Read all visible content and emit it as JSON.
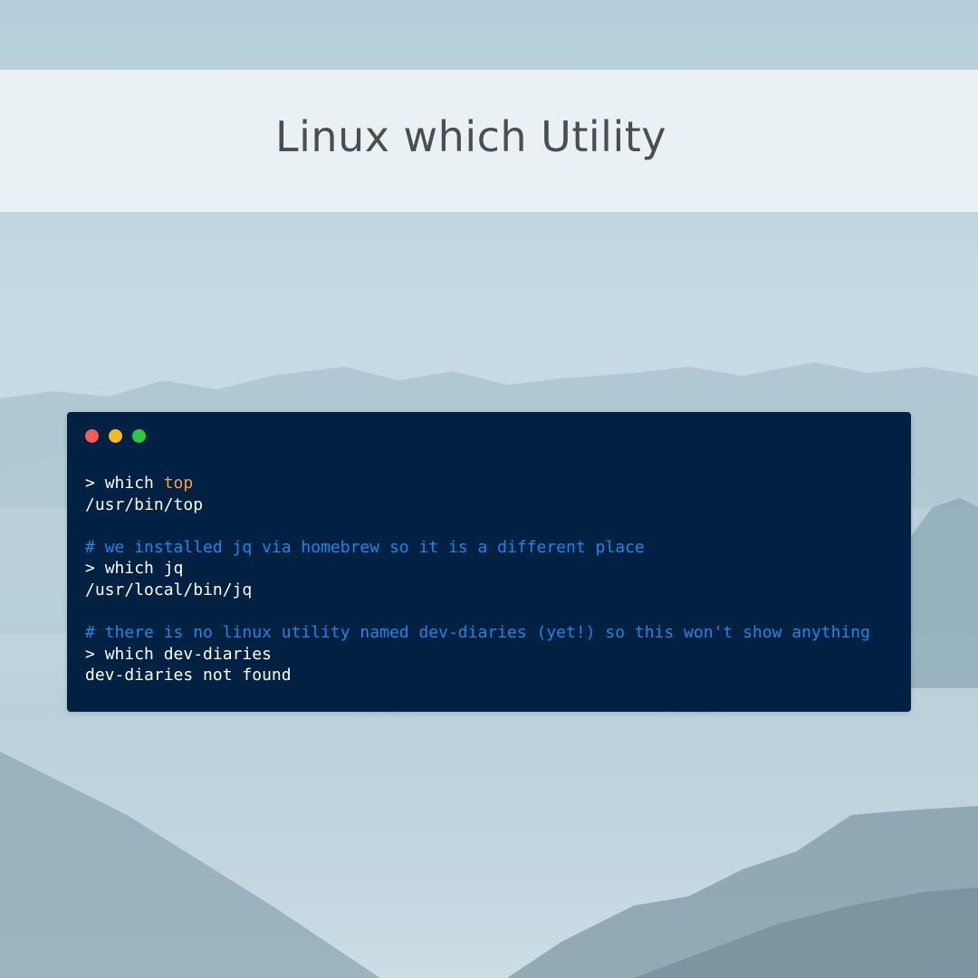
{
  "title": "Linux which Utility",
  "colors": {
    "terminal_bg": "#012142",
    "command_text": "#ffffff",
    "output_text": "#ffffff",
    "highlight": "#f7a04a",
    "comment": "#1e86e8",
    "dot_red": "#f35c55",
    "dot_yellow": "#f6b828",
    "dot_green": "#2bc840"
  },
  "terminal": {
    "window_controls": [
      "close",
      "minimize",
      "maximize"
    ],
    "lines": [
      {
        "kind": "command",
        "prompt": "> ",
        "cmd": "which ",
        "arg": "top"
      },
      {
        "kind": "output",
        "text": "/usr/bin/top"
      },
      {
        "kind": "blank"
      },
      {
        "kind": "comment",
        "text": "# we installed jq via homebrew so it is a different place"
      },
      {
        "kind": "command",
        "prompt": "> ",
        "cmd": "which jq"
      },
      {
        "kind": "output",
        "text": "/usr/local/bin/jq"
      },
      {
        "kind": "blank"
      },
      {
        "kind": "comment",
        "text": "# there is no linux utility named dev-diaries (yet!) so this won't show anything"
      },
      {
        "kind": "command",
        "prompt": "> ",
        "cmd": "which dev-diaries"
      },
      {
        "kind": "output",
        "text": "dev-diaries not found"
      }
    ]
  }
}
